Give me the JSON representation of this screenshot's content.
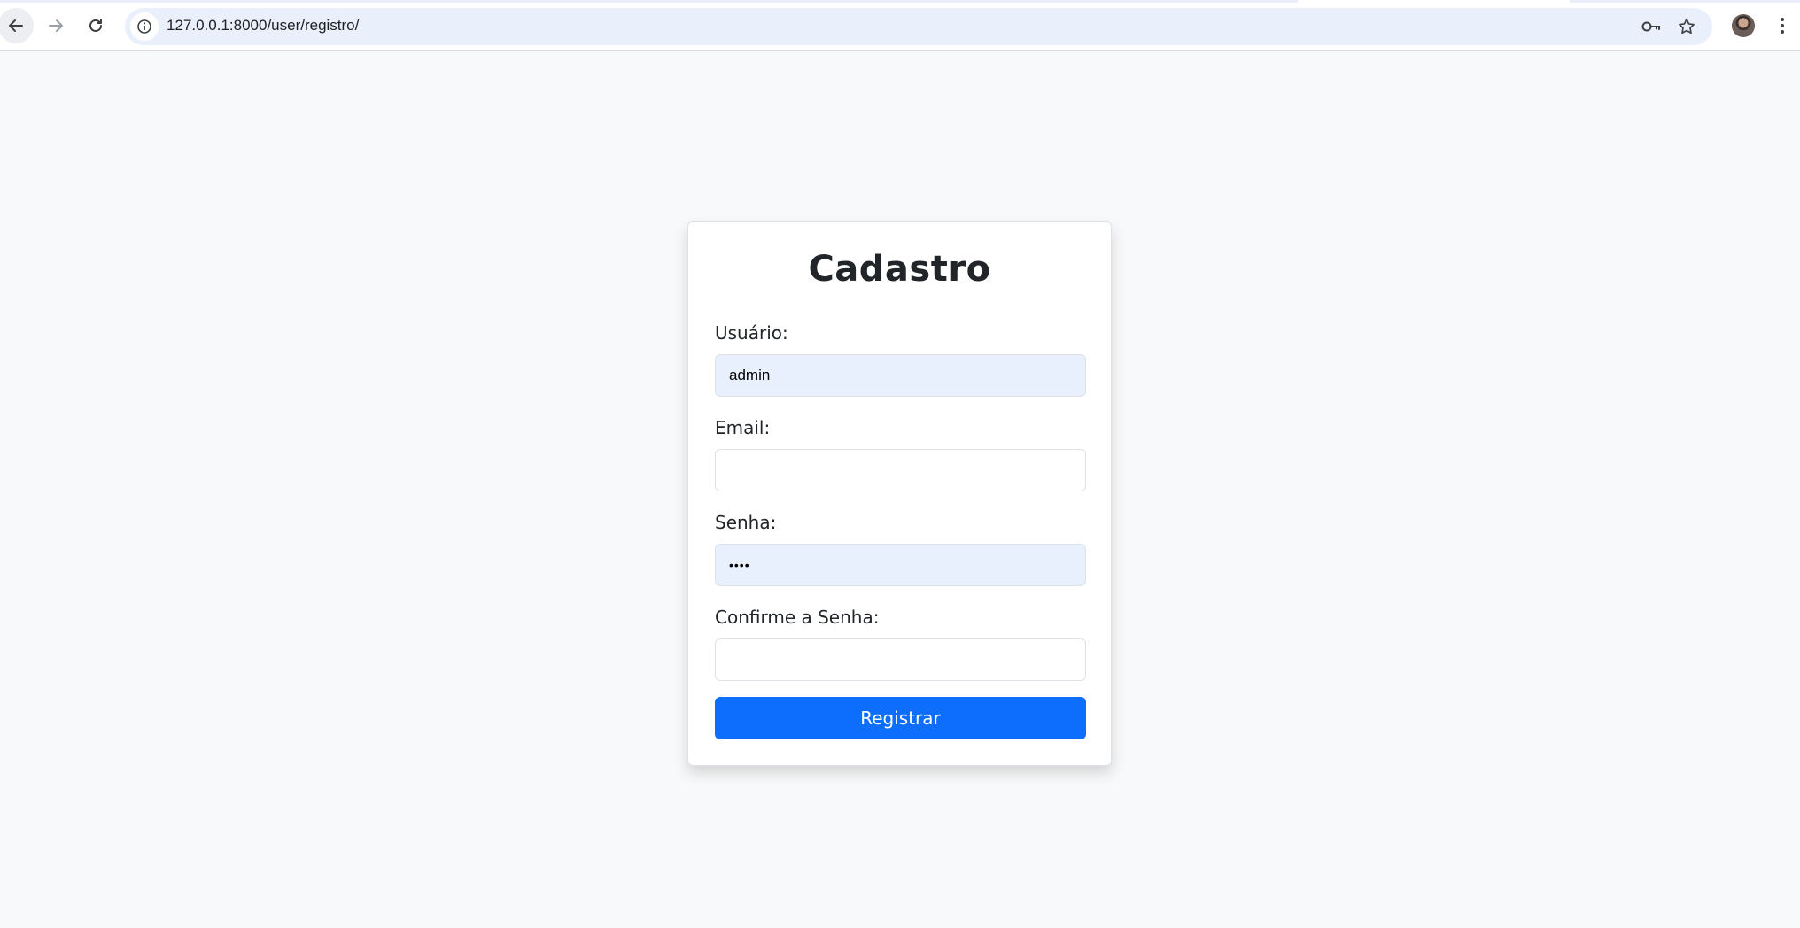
{
  "browser": {
    "url": "127.0.0.1:8000/user/registro/",
    "icons": {
      "back": "arrow-left-icon",
      "forward": "arrow-right-icon",
      "reload": "reload-icon",
      "site_info": "info-icon",
      "password_key": "key-icon",
      "bookmark": "star-icon",
      "menu": "more-vert-icon"
    }
  },
  "form": {
    "title": "Cadastro",
    "fields": [
      {
        "label": "Usuário:",
        "value": "admin",
        "type": "text"
      },
      {
        "label": "Email:",
        "value": "",
        "type": "email"
      },
      {
        "label": "Senha:",
        "value": "••••",
        "type": "password"
      },
      {
        "label": "Confirme a Senha:",
        "value": "",
        "type": "password"
      }
    ],
    "submit_label": "Registrar"
  },
  "colors": {
    "primary": "#0d6efd",
    "autofill": "#e8f0fe",
    "page_bg": "#f8f9fa"
  }
}
